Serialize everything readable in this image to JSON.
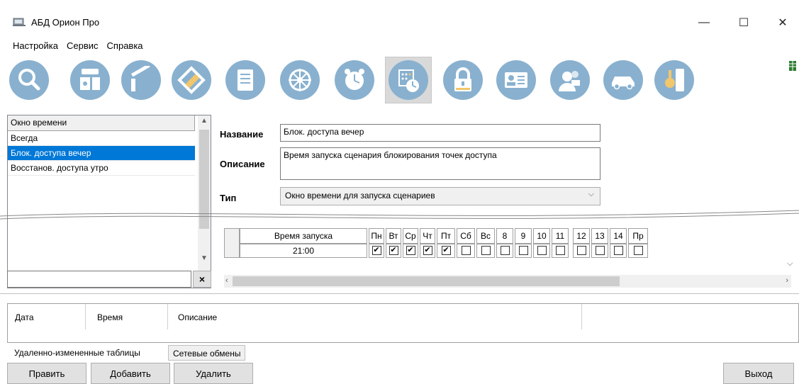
{
  "window": {
    "title": "АБД Орион Про",
    "minimize": "—",
    "maximize": "☐",
    "close": "✕"
  },
  "menu": [
    "Настройка",
    "Сервис",
    "Справка"
  ],
  "toolbar": {
    "icons": [
      "search-icon",
      "reader-icon",
      "barrier-icon",
      "map-icon",
      "document-icon",
      "wheel-icon",
      "clock-icon",
      "schedule-icon",
      "lock-icon",
      "id-card-icon",
      "person-icon",
      "car-icon",
      "key-icon"
    ],
    "active_index": 7,
    "accent": "#89b1cf"
  },
  "left_list": {
    "header": "Окно времени",
    "items": [
      "Всегда",
      "Блок. доступа вечер",
      "Восстанов. доступа утро"
    ],
    "selected_index": 1,
    "filter_value": "",
    "clear_label": "×"
  },
  "form": {
    "name_label": "Название",
    "name_value": "Блок. доступа вечер",
    "desc_label": "Описание",
    "desc_value": "Время запуска сценария блокирования точек доступа",
    "type_label": "Тип",
    "type_value": "Окно времени для запуска сценариев"
  },
  "schedule": {
    "columns": [
      "Время запуска",
      "Пн",
      "Вт",
      "Ср",
      "Чт",
      "Пт",
      "Сб",
      "Вс",
      "8",
      "9",
      "10",
      "11",
      "12",
      "13",
      "14",
      "Пр"
    ],
    "rows": [
      {
        "time": "21:00",
        "checks": [
          true,
          true,
          true,
          true,
          true,
          false,
          false,
          false,
          false,
          false,
          false,
          false,
          false,
          false,
          false
        ]
      }
    ]
  },
  "events": {
    "columns": [
      "Дата",
      "Время",
      "Описание"
    ]
  },
  "tabs": [
    "Удаленно-измененные таблицы",
    "Сетевые обмены"
  ],
  "buttons": {
    "edit": "Править",
    "add": "Добавить",
    "delete": "Удалить",
    "exit": "Выход"
  }
}
